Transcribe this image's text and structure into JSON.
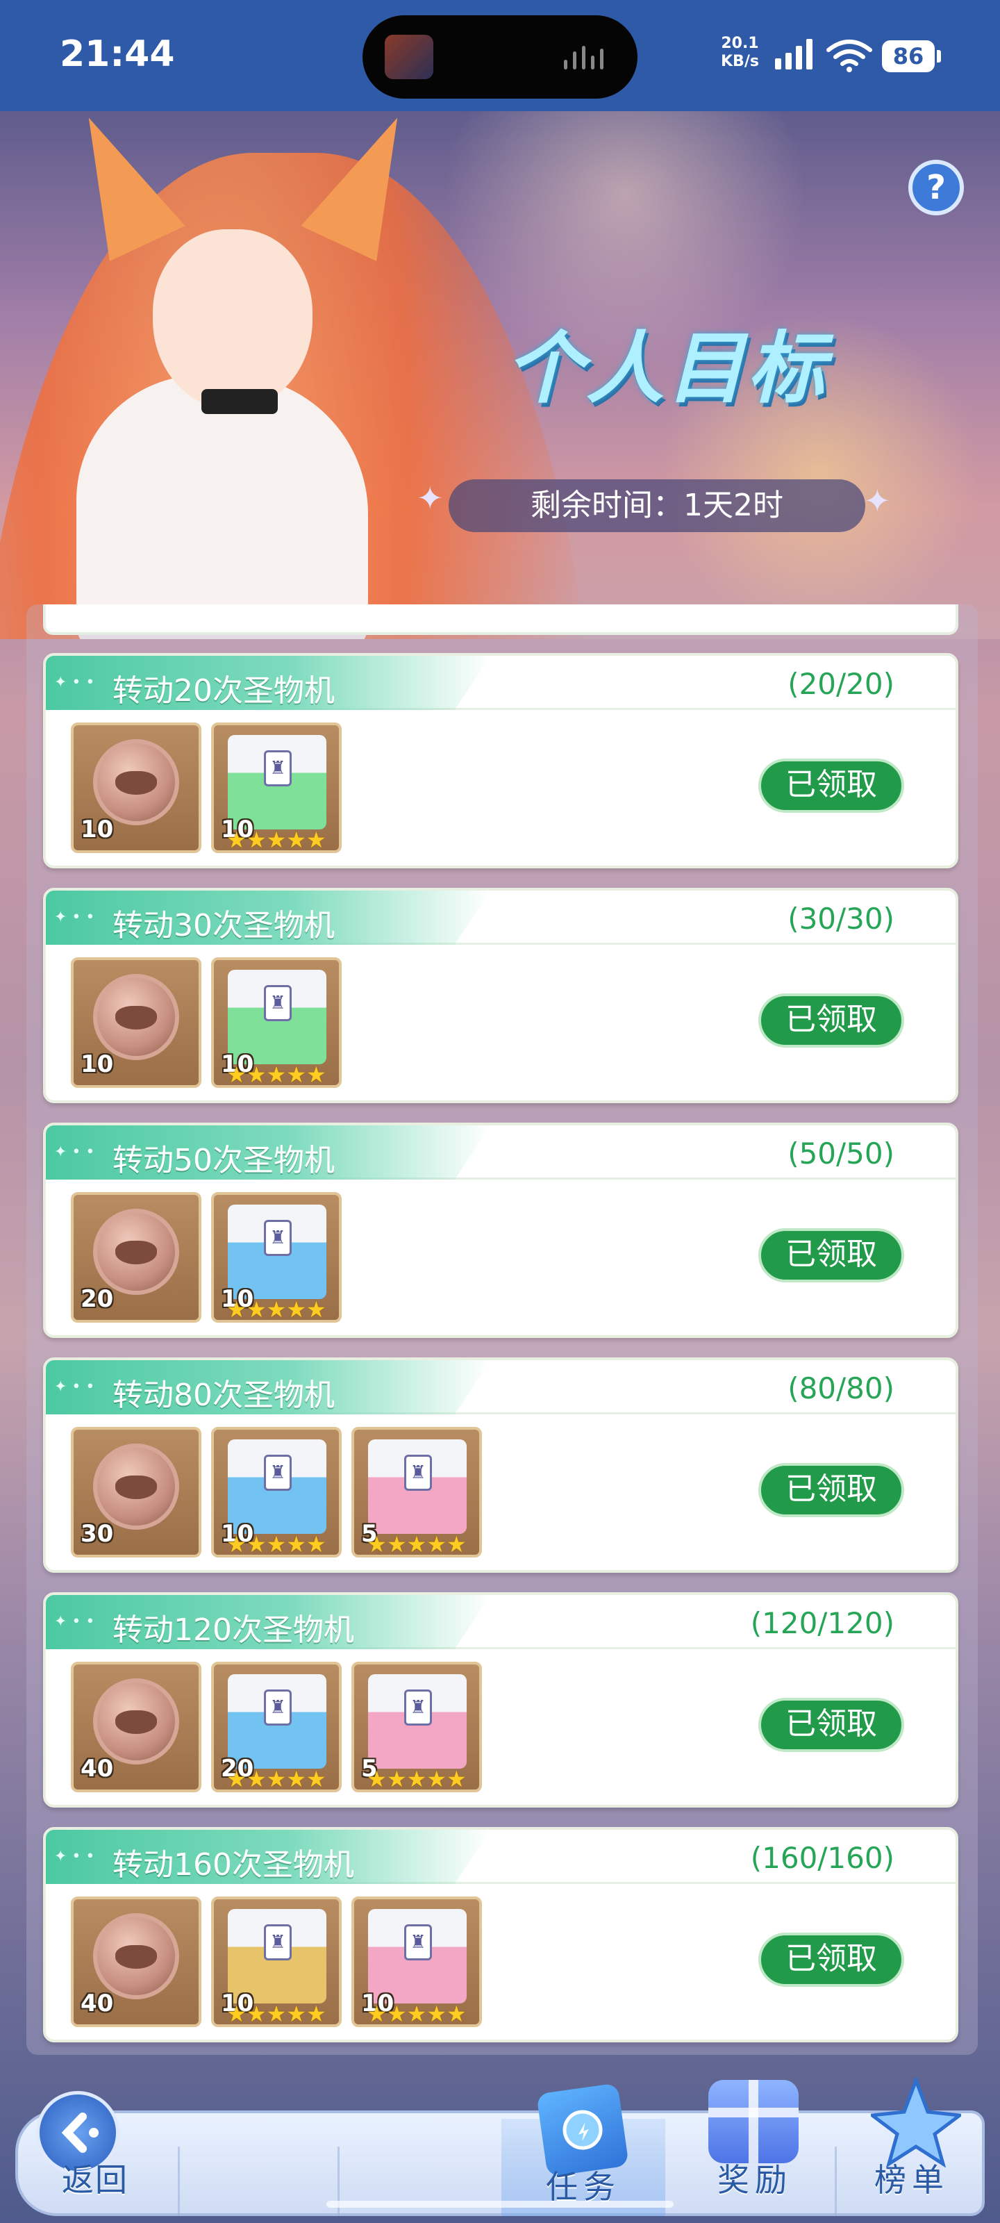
{
  "status_bar": {
    "time": "21:44",
    "net_speed_value": "20.1",
    "net_speed_unit": "KB/s",
    "battery": "86",
    "icons": [
      "media-thumbnail-icon",
      "audio-wave-icon",
      "signal-icon",
      "wifi-icon",
      "battery-icon"
    ]
  },
  "header": {
    "title": "个人目标",
    "timer": "剩余时间：1天2时",
    "help_icon": "?"
  },
  "tasks": [
    {
      "title": "转动20次圣物机",
      "progress": "(20/20)",
      "status": "已领取",
      "rewards": [
        {
          "kind": "coin",
          "count": "10"
        },
        {
          "kind": "box-green",
          "count": "10",
          "stars": "★★★★★"
        }
      ]
    },
    {
      "title": "转动30次圣物机",
      "progress": "(30/30)",
      "status": "已领取",
      "rewards": [
        {
          "kind": "coin",
          "count": "10"
        },
        {
          "kind": "box-green",
          "count": "10",
          "stars": "★★★★★"
        }
      ]
    },
    {
      "title": "转动50次圣物机",
      "progress": "(50/50)",
      "status": "已领取",
      "rewards": [
        {
          "kind": "coin",
          "count": "20"
        },
        {
          "kind": "box-blue",
          "count": "10",
          "stars": "★★★★★"
        }
      ]
    },
    {
      "title": "转动80次圣物机",
      "progress": "(80/80)",
      "status": "已领取",
      "rewards": [
        {
          "kind": "coin",
          "count": "30"
        },
        {
          "kind": "box-blue",
          "count": "10",
          "stars": "★★★★★"
        },
        {
          "kind": "box-pink",
          "count": "5",
          "stars": "★★★★★"
        }
      ]
    },
    {
      "title": "转动120次圣物机",
      "progress": "(120/120)",
      "status": "已领取",
      "rewards": [
        {
          "kind": "coin",
          "count": "40"
        },
        {
          "kind": "box-blue",
          "count": "20",
          "stars": "★★★★★"
        },
        {
          "kind": "box-pink",
          "count": "5",
          "stars": "★★★★★"
        }
      ]
    },
    {
      "title": "转动160次圣物机",
      "progress": "(160/160)",
      "status": "已领取",
      "rewards": [
        {
          "kind": "coin",
          "count": "40"
        },
        {
          "kind": "box-gold",
          "count": "10",
          "stars": "★★★★★"
        },
        {
          "kind": "box-pink",
          "count": "10",
          "stars": "★★★★★"
        }
      ]
    }
  ],
  "bottom_nav": {
    "back": "返回",
    "tasks": "任务",
    "rewards": "奖励",
    "rankings": "榜单"
  },
  "colors": {
    "accent_green": "#219a4a",
    "progress_green": "#27a557",
    "ribbon_teal": "#4cc9a2",
    "status_bar_blue": "#2e5aa8",
    "title_cyan": "#aef0ff"
  }
}
